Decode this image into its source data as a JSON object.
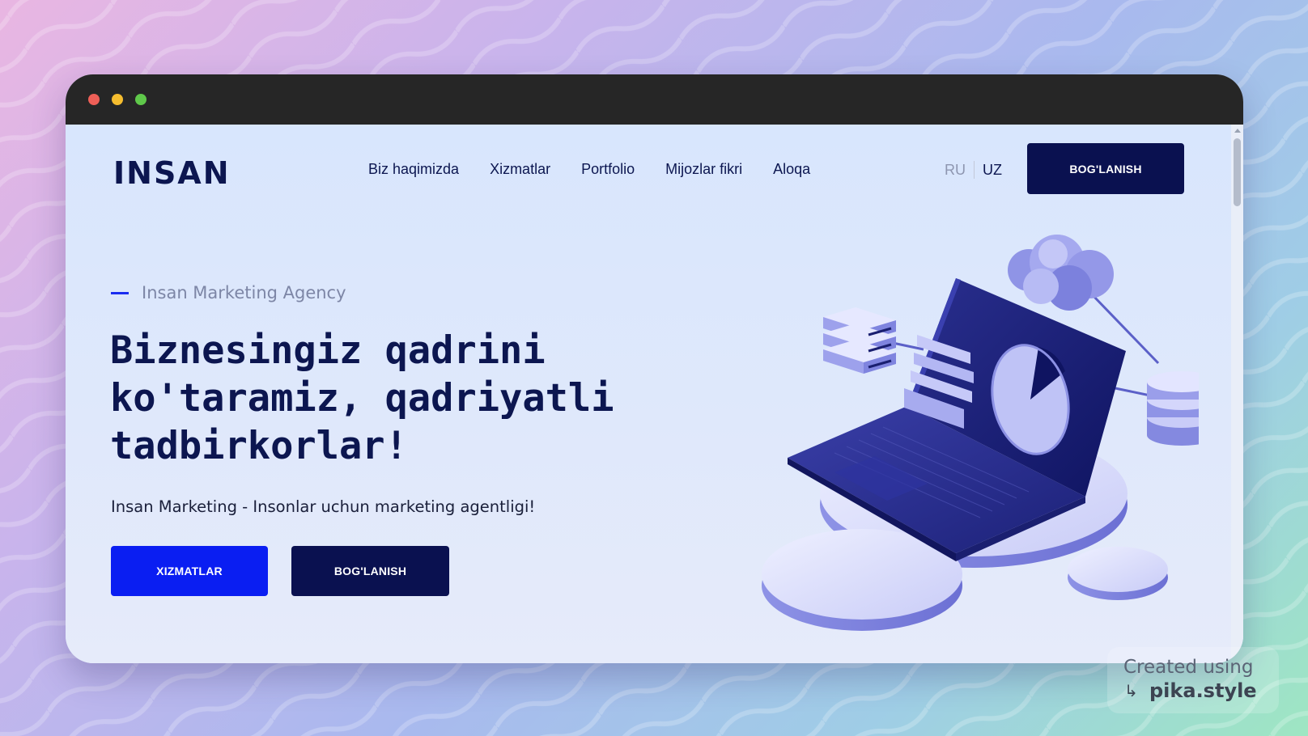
{
  "header": {
    "logo": "INSAN",
    "nav": [
      "Biz haqimizda",
      "Xizmatlar",
      "Portfolio",
      "Mijozlar fikri",
      "Aloqa"
    ],
    "languages": {
      "inactive": "RU",
      "active": "UZ"
    },
    "cta_label": "BOG'LANISH"
  },
  "hero": {
    "eyebrow": "Insan Marketing Agency",
    "title_lines": [
      "Biznesingiz qadrini",
      "ko'taramiz, qadriyatli",
      "tadbirkorlar!"
    ],
    "subtitle": "Insan Marketing - Insonlar uchun marketing agentligi!",
    "primary_button": "XIZMATLAR",
    "secondary_button": "BOG'LANISH",
    "illustration": "laptop-cloud-database-illustration"
  },
  "watermark": {
    "line1": "Created using",
    "line2": "pika.style",
    "icon": "arrow-return-icon"
  },
  "colors": {
    "navy": "#0a1150",
    "brand_blue": "#0a1ef2",
    "text_dark": "#0c1650",
    "muted": "#7d86a6",
    "page_bg": "#dde8fb",
    "titlebar": "#262626"
  }
}
